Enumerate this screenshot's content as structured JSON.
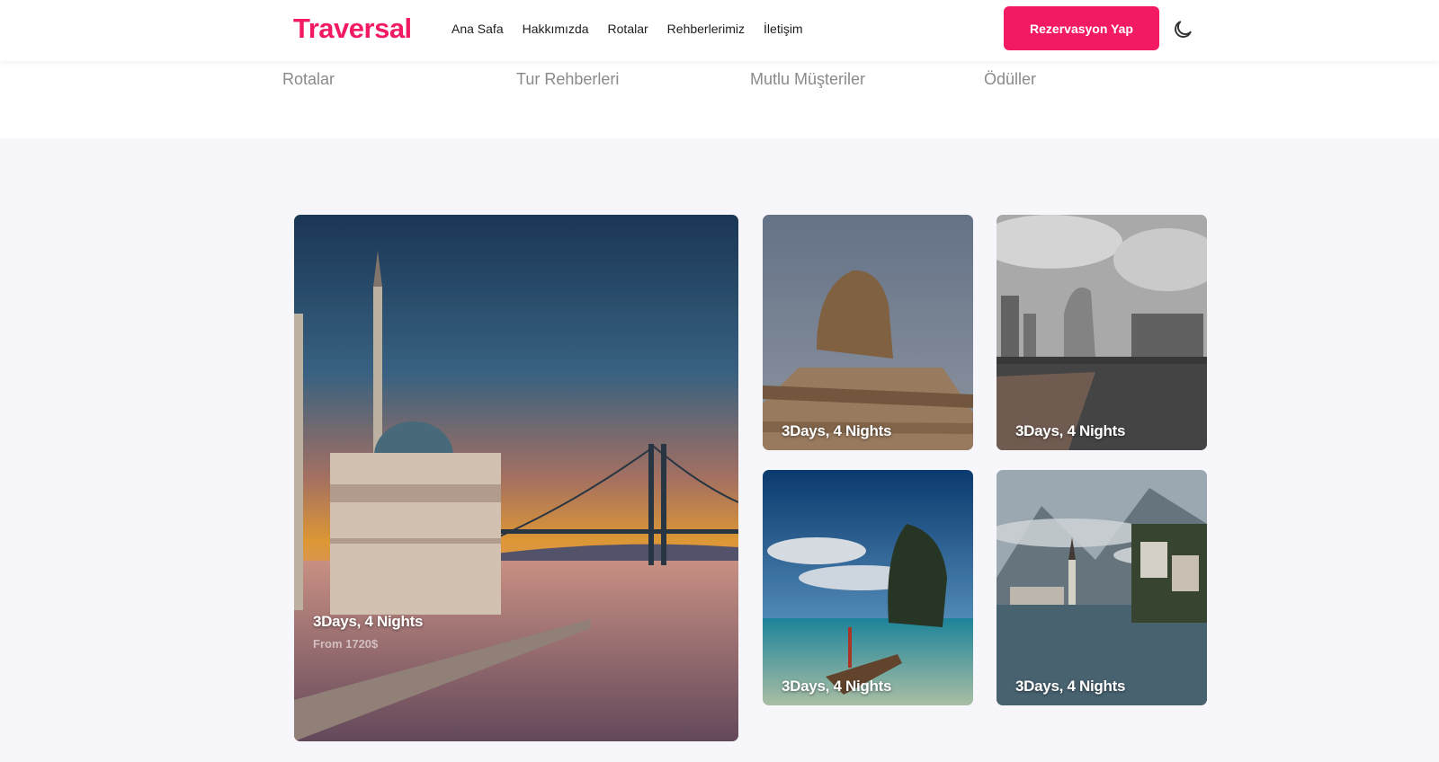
{
  "header": {
    "logo": "Traversal",
    "nav": [
      "Ana Safa",
      "Hakkımızda",
      "Rotalar",
      "Rehberlerimiz",
      "İletişim"
    ],
    "cta_label": "Rezervasyon Yap",
    "theme_icon": "moon-icon"
  },
  "stats": {
    "labels": [
      "Rotalar",
      "Tur Rehberleri",
      "Mutlu Müşteriler",
      "Ödüller"
    ]
  },
  "tours": [
    {
      "title": "3Days, 4 Nights",
      "price": "From 1720$",
      "scene": "istanbul-ortakoy-mosque-bridge-sunset"
    },
    {
      "title": "3Days, 4 Nights",
      "scene": "egypt-sphinx"
    },
    {
      "title": "3Days, 4 Nights",
      "scene": "singapore-merlion"
    },
    {
      "title": "3Days, 4 Nights",
      "scene": "thailand-longtail-boat-beach"
    },
    {
      "title": "3Days, 4 Nights",
      "scene": "hallstatt-lake-village"
    }
  ],
  "colors": {
    "brand": "#f21b63",
    "stat_text": "#8a8a8a",
    "section_bg": "#f7f7fb"
  }
}
